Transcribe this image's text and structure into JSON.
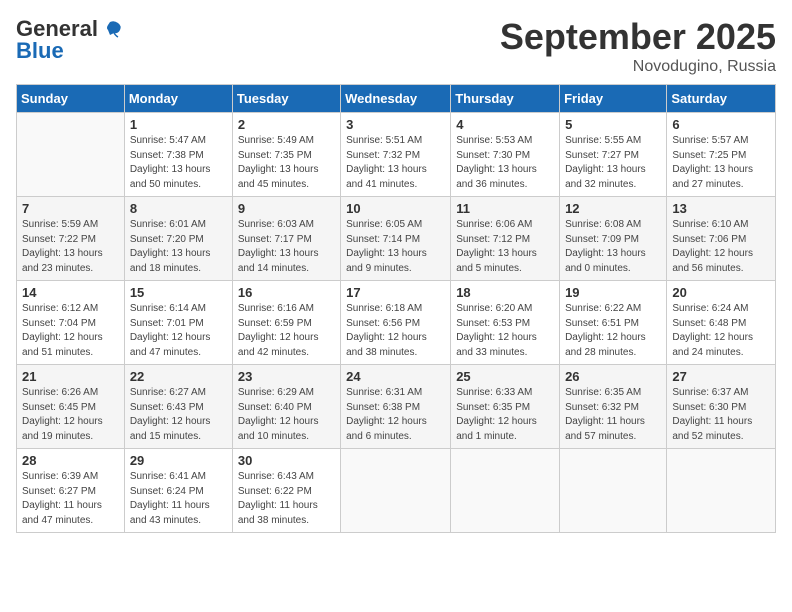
{
  "header": {
    "logo_general": "General",
    "logo_blue": "Blue",
    "month_title": "September 2025",
    "location": "Novodugino, Russia"
  },
  "weekdays": [
    "Sunday",
    "Monday",
    "Tuesday",
    "Wednesday",
    "Thursday",
    "Friday",
    "Saturday"
  ],
  "weeks": [
    [
      {
        "num": "",
        "info": ""
      },
      {
        "num": "1",
        "info": "Sunrise: 5:47 AM\nSunset: 7:38 PM\nDaylight: 13 hours\nand 50 minutes."
      },
      {
        "num": "2",
        "info": "Sunrise: 5:49 AM\nSunset: 7:35 PM\nDaylight: 13 hours\nand 45 minutes."
      },
      {
        "num": "3",
        "info": "Sunrise: 5:51 AM\nSunset: 7:32 PM\nDaylight: 13 hours\nand 41 minutes."
      },
      {
        "num": "4",
        "info": "Sunrise: 5:53 AM\nSunset: 7:30 PM\nDaylight: 13 hours\nand 36 minutes."
      },
      {
        "num": "5",
        "info": "Sunrise: 5:55 AM\nSunset: 7:27 PM\nDaylight: 13 hours\nand 32 minutes."
      },
      {
        "num": "6",
        "info": "Sunrise: 5:57 AM\nSunset: 7:25 PM\nDaylight: 13 hours\nand 27 minutes."
      }
    ],
    [
      {
        "num": "7",
        "info": "Sunrise: 5:59 AM\nSunset: 7:22 PM\nDaylight: 13 hours\nand 23 minutes."
      },
      {
        "num": "8",
        "info": "Sunrise: 6:01 AM\nSunset: 7:20 PM\nDaylight: 13 hours\nand 18 minutes."
      },
      {
        "num": "9",
        "info": "Sunrise: 6:03 AM\nSunset: 7:17 PM\nDaylight: 13 hours\nand 14 minutes."
      },
      {
        "num": "10",
        "info": "Sunrise: 6:05 AM\nSunset: 7:14 PM\nDaylight: 13 hours\nand 9 minutes."
      },
      {
        "num": "11",
        "info": "Sunrise: 6:06 AM\nSunset: 7:12 PM\nDaylight: 13 hours\nand 5 minutes."
      },
      {
        "num": "12",
        "info": "Sunrise: 6:08 AM\nSunset: 7:09 PM\nDaylight: 13 hours\nand 0 minutes."
      },
      {
        "num": "13",
        "info": "Sunrise: 6:10 AM\nSunset: 7:06 PM\nDaylight: 12 hours\nand 56 minutes."
      }
    ],
    [
      {
        "num": "14",
        "info": "Sunrise: 6:12 AM\nSunset: 7:04 PM\nDaylight: 12 hours\nand 51 minutes."
      },
      {
        "num": "15",
        "info": "Sunrise: 6:14 AM\nSunset: 7:01 PM\nDaylight: 12 hours\nand 47 minutes."
      },
      {
        "num": "16",
        "info": "Sunrise: 6:16 AM\nSunset: 6:59 PM\nDaylight: 12 hours\nand 42 minutes."
      },
      {
        "num": "17",
        "info": "Sunrise: 6:18 AM\nSunset: 6:56 PM\nDaylight: 12 hours\nand 38 minutes."
      },
      {
        "num": "18",
        "info": "Sunrise: 6:20 AM\nSunset: 6:53 PM\nDaylight: 12 hours\nand 33 minutes."
      },
      {
        "num": "19",
        "info": "Sunrise: 6:22 AM\nSunset: 6:51 PM\nDaylight: 12 hours\nand 28 minutes."
      },
      {
        "num": "20",
        "info": "Sunrise: 6:24 AM\nSunset: 6:48 PM\nDaylight: 12 hours\nand 24 minutes."
      }
    ],
    [
      {
        "num": "21",
        "info": "Sunrise: 6:26 AM\nSunset: 6:45 PM\nDaylight: 12 hours\nand 19 minutes."
      },
      {
        "num": "22",
        "info": "Sunrise: 6:27 AM\nSunset: 6:43 PM\nDaylight: 12 hours\nand 15 minutes."
      },
      {
        "num": "23",
        "info": "Sunrise: 6:29 AM\nSunset: 6:40 PM\nDaylight: 12 hours\nand 10 minutes."
      },
      {
        "num": "24",
        "info": "Sunrise: 6:31 AM\nSunset: 6:38 PM\nDaylight: 12 hours\nand 6 minutes."
      },
      {
        "num": "25",
        "info": "Sunrise: 6:33 AM\nSunset: 6:35 PM\nDaylight: 12 hours\nand 1 minute."
      },
      {
        "num": "26",
        "info": "Sunrise: 6:35 AM\nSunset: 6:32 PM\nDaylight: 11 hours\nand 57 minutes."
      },
      {
        "num": "27",
        "info": "Sunrise: 6:37 AM\nSunset: 6:30 PM\nDaylight: 11 hours\nand 52 minutes."
      }
    ],
    [
      {
        "num": "28",
        "info": "Sunrise: 6:39 AM\nSunset: 6:27 PM\nDaylight: 11 hours\nand 47 minutes."
      },
      {
        "num": "29",
        "info": "Sunrise: 6:41 AM\nSunset: 6:24 PM\nDaylight: 11 hours\nand 43 minutes."
      },
      {
        "num": "30",
        "info": "Sunrise: 6:43 AM\nSunset: 6:22 PM\nDaylight: 11 hours\nand 38 minutes."
      },
      {
        "num": "",
        "info": ""
      },
      {
        "num": "",
        "info": ""
      },
      {
        "num": "",
        "info": ""
      },
      {
        "num": "",
        "info": ""
      }
    ]
  ]
}
